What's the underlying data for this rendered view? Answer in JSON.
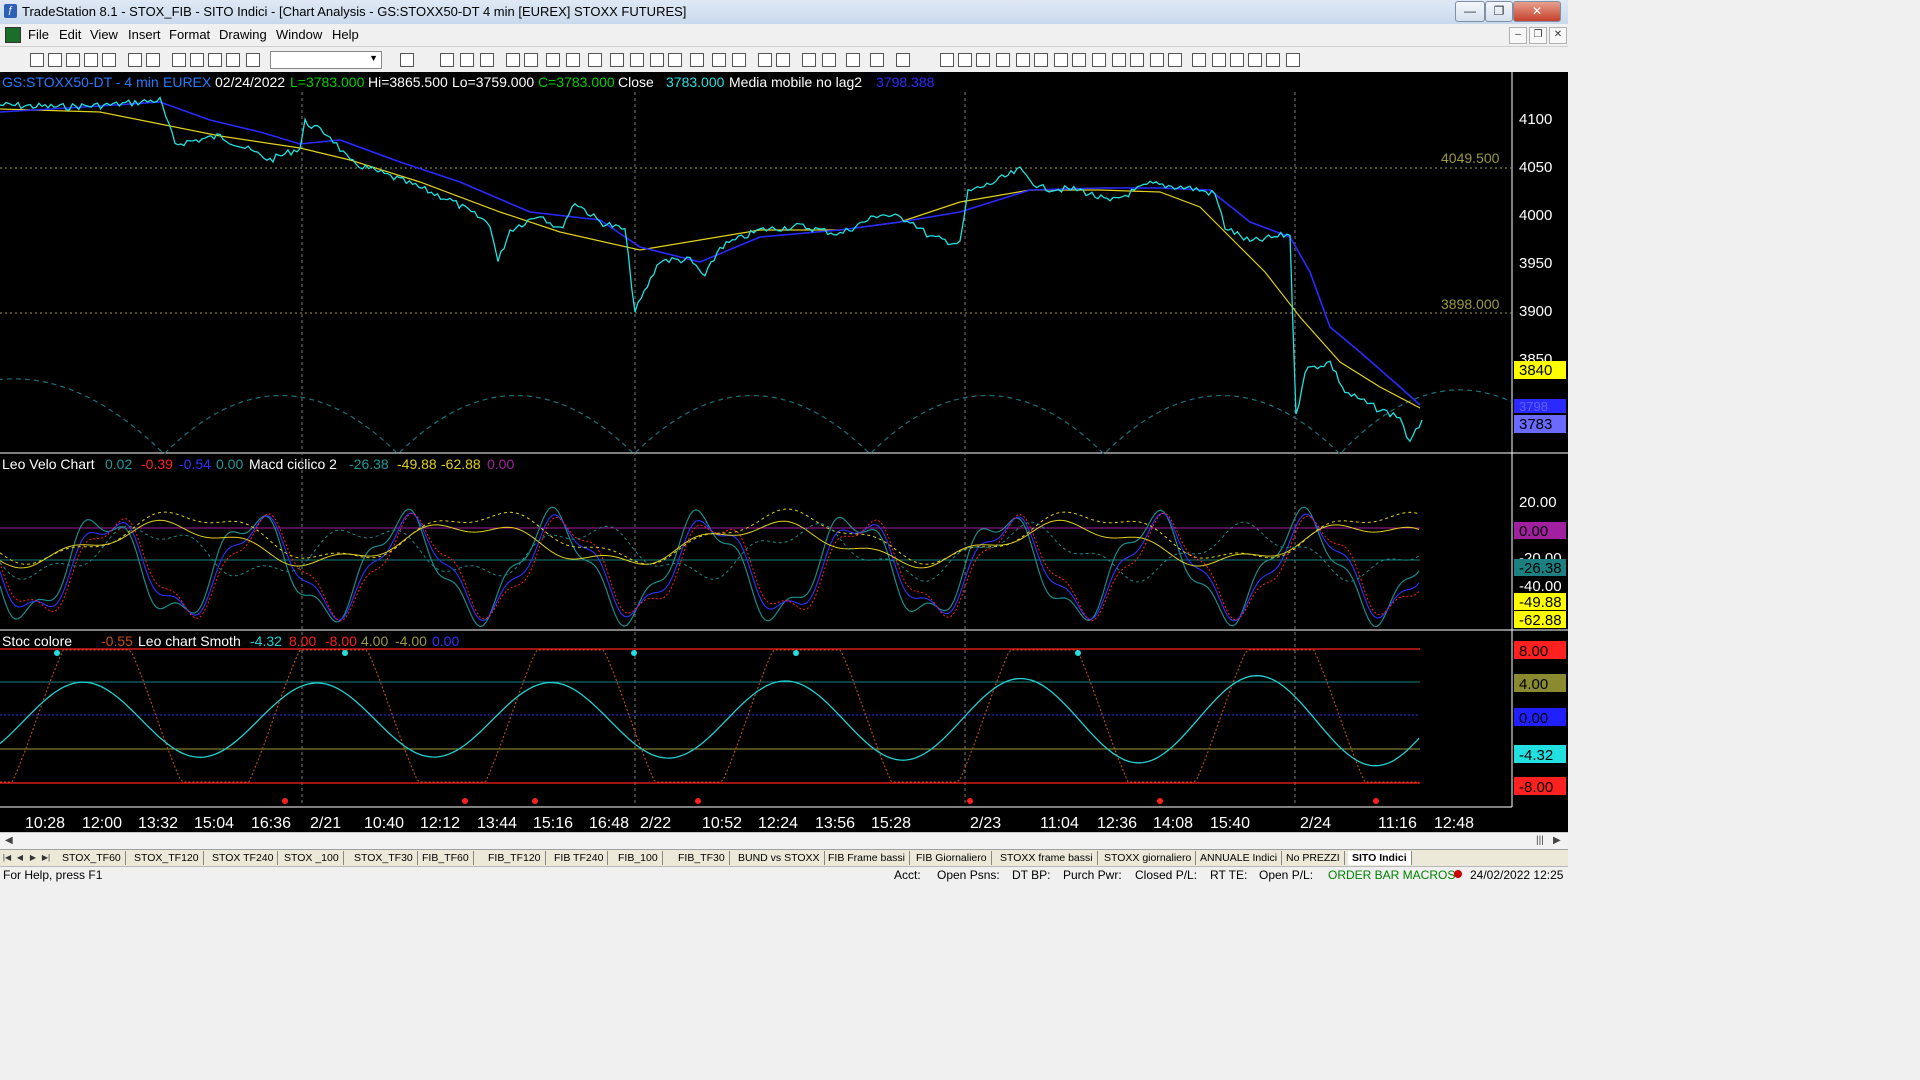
{
  "window": {
    "title": "TradeStation 8.1 - STOX_FIB - SITO Indici - [Chart Analysis - GS:STOXX50-DT  4 min  [EUREX] STOXX FUTURES]",
    "minimize": "—",
    "restore": "❐",
    "close": "✕"
  },
  "menu": {
    "items": [
      "File",
      "Edit",
      "View",
      "Insert",
      "Format",
      "Drawing",
      "Window",
      "Help"
    ],
    "mdi_minimize": "–",
    "mdi_restore": "❐",
    "mdi_close": "✕"
  },
  "chart": {
    "header": {
      "symbol": "GS:STOXX50-DT - 4 min",
      "exchange": "EUREX",
      "date": "02/24/2022",
      "last": "L=3783.000",
      "high": "Hi=3865.500",
      "low": "Lo=3759.000",
      "close_c": "C=3783.000",
      "close_label": "Close",
      "close_value": "3783.000",
      "ma_label": "Media mobile no lag2",
      "ma_value": "3798.388"
    },
    "price_axis": [
      "4100",
      "4050",
      "4000",
      "3950",
      "3900",
      "3850"
    ],
    "price_levels": {
      "upper": "4049.500",
      "lower": "3898.000"
    },
    "price_badges": {
      "yellow": "3840",
      "blue1": "3798",
      "blue2": "3783"
    },
    "indicator1": {
      "header": {
        "name": "Leo Velo Chart",
        "v1": "0.02",
        "v2": "-0.39",
        "v3": "-0.54",
        "v4": "0.00",
        "name2": "Macd ciclico 2",
        "v5": "-26.38",
        "v6": "-49.88",
        "v7": "-62.88",
        "v8": "0.00"
      },
      "axis": [
        "20.00",
        "-20.00",
        "-40.00"
      ],
      "badges": {
        "b1": "0.00",
        "b2": "-26.38",
        "b3": "-49.88",
        "b4": "-62.88"
      }
    },
    "indicator2": {
      "header": {
        "name": "Stoc colore",
        "v1": "-0.55",
        "name2": "Leo chart Smoth",
        "v2": "-4.32",
        "v3": "8.00",
        "v4": "-8.00",
        "v5": "4.00",
        "v6": "-4.00",
        "v7": "0.00"
      },
      "badges": {
        "b1": "8.00",
        "b2": "4.00",
        "b3": "0.00",
        "b4": "-4.32",
        "b5": "-8.00"
      }
    },
    "time_axis": [
      "10:28",
      "12:00",
      "13:32",
      "15:04",
      "16:36",
      "2/21",
      "10:40",
      "12:12",
      "13:44",
      "15:16",
      "16:48",
      "2/22",
      "10:52",
      "12:24",
      "13:56",
      "15:28",
      "2/23",
      "11:04",
      "12:36",
      "14:08",
      "15:40",
      "2/24",
      "11:16",
      "12:48"
    ],
    "colors": {
      "price": "#22e0e0",
      "ma_blue": "#2a2aff",
      "ma_yellow": "#e0d020",
      "grid_level": "#9a9a40",
      "cycle": "#1d6e7a",
      "badge_yellow": "#ffff00"
    }
  },
  "tabs": {
    "items": [
      "STOX_TF60",
      "STOX_TF120",
      "STOX TF240",
      "STOX _100",
      "STOX_TF30",
      "FIB_TF60",
      "FIB_TF120",
      "FIB TF240",
      "FIB_100",
      "FIB_TF30",
      "BUND vs STOXX",
      "FIB Frame bassi",
      "FIB Giornaliero",
      "STOXX frame bassi",
      "STOXX giornaliero",
      "ANNUALE Indici",
      "No PREZZI",
      "SITO Indici"
    ],
    "active": "SITO Indici"
  },
  "status": {
    "help": "For Help, press F1",
    "acct": "Acct:",
    "open_psns": "Open Psns:",
    "dt_bp": "DT BP:",
    "purch_pwr": "Purch Pwr:",
    "closed_pl": "Closed P/L:",
    "rt_te": "RT TE:",
    "open_pl": "Open P/L:",
    "macros": "ORDER BAR  MACROS",
    "datetime": "24/02/2022 12:25"
  }
}
